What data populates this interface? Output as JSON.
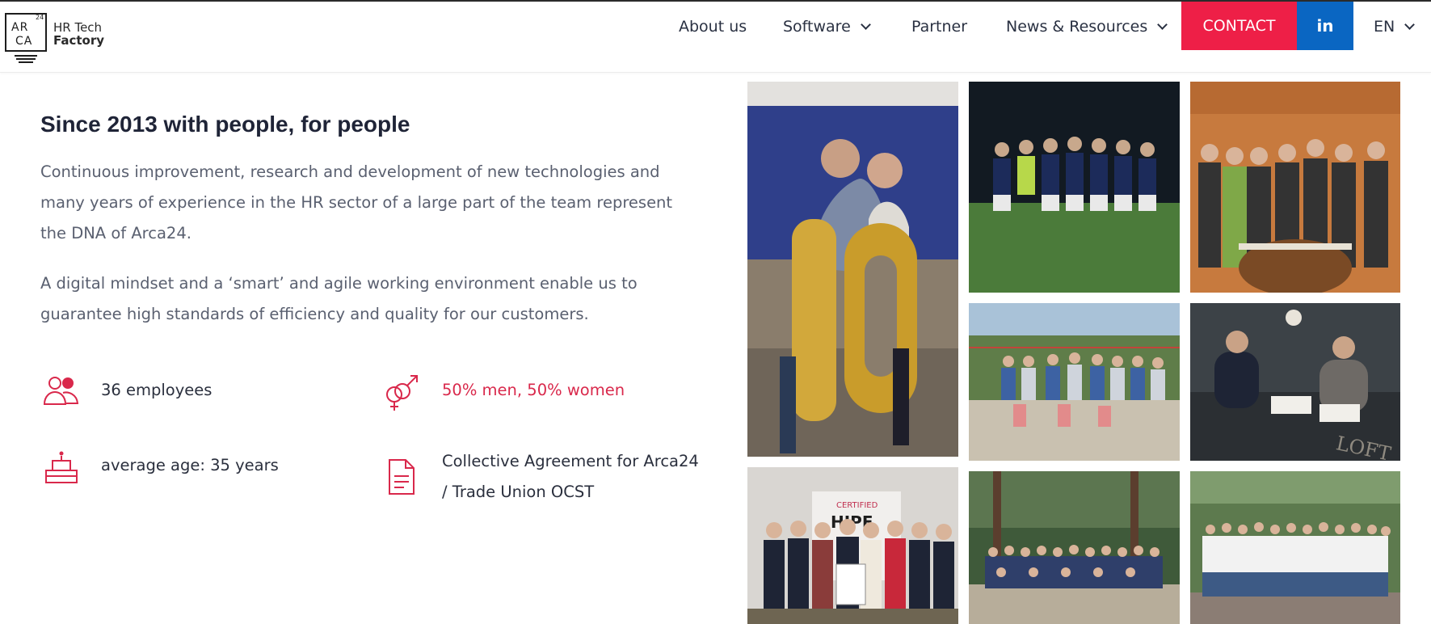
{
  "brand": {
    "logo_letters": [
      "AR",
      "CA",
      "24"
    ],
    "logo_line1": "HR Tech",
    "logo_line2": "Factory"
  },
  "nav": {
    "about": "About us",
    "software": "Software",
    "partner": "Partner",
    "news": "News & Resources",
    "contact": "CONTACT",
    "linkedin": "in",
    "language": "EN"
  },
  "content": {
    "title": "Since 2013 with people, for people",
    "paragraph1": "Continuous improvement, research and development of new technologies and many years of experience in the HR sector of a large part of the team represent the DNA of Arca24.",
    "paragraph2": "A digital mindset and a ‘smart’ and agile working environment enable us to guarantee high standards of efficiency and quality for our customers."
  },
  "stats": {
    "employees": "36 employees",
    "gender": "50% men, 50% women",
    "age": "average age: 35 years",
    "agreement": "Collective Agreement for Arca24 / Trade Union OCST"
  },
  "colors": {
    "accent": "#ee1f47",
    "linkedin": "#0a66c2",
    "text_dark": "#1f2437",
    "text_muted": "#5a6070"
  },
  "icons": {
    "employees": "people-icon",
    "gender": "gender-icon",
    "age": "cake-icon",
    "agreement": "document-icon"
  }
}
